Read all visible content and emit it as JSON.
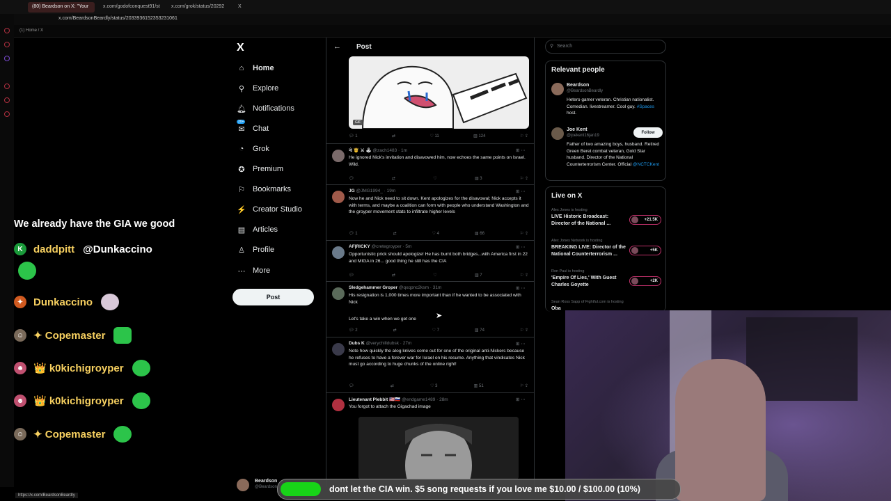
{
  "browser": {
    "tabs": [
      {
        "label": "(80) Beardson on X: \"Your",
        "active": true
      },
      {
        "label": "x.com/godofconquest91/st",
        "active": false
      },
      {
        "label": "x.com/grok/status/20292",
        "active": false
      },
      {
        "label": "X",
        "active": false
      }
    ],
    "url": "x.com/BeardsonBeardly/status/2033936152353231061",
    "bookmark": "(1) Home / X",
    "status_url": "https://x.com/BeardsonBeardly"
  },
  "sidebar": {
    "logo": "X",
    "items": [
      {
        "label": "Home",
        "icon": "⌂"
      },
      {
        "label": "Explore",
        "icon": "⚲"
      },
      {
        "label": "Notifications",
        "icon": "🔔︎"
      },
      {
        "label": "Chat",
        "icon": "✉"
      },
      {
        "label": "Grok",
        "icon": "◔"
      },
      {
        "label": "Premium",
        "icon": "✪"
      },
      {
        "label": "Bookmarks",
        "icon": "⚐"
      },
      {
        "label": "Creator Studio",
        "icon": "⚡"
      },
      {
        "label": "Articles",
        "icon": "▤"
      },
      {
        "label": "Profile",
        "icon": "♙"
      },
      {
        "label": "More",
        "icon": "⋯"
      }
    ],
    "post_label": "Post",
    "chat_badge": "20+",
    "account": {
      "name": "Beardson",
      "handle": "@Beardson"
    }
  },
  "timeline": {
    "title": "Post",
    "gif_badge": "GIF",
    "gif_actions": {
      "reply": "1",
      "repost": "",
      "like": "11",
      "views": "124"
    },
    "tweets": [
      {
        "name": "ᐛ 🤴 ⚔ 🕹",
        "handle": "@zach1483 · 1m",
        "text": "He ignored Nick's invitation and disavowed him, now echoes the same points on Israel. Wild.",
        "reply": "",
        "like": "",
        "views": "3"
      },
      {
        "name": "JG",
        "handle": "@JMG1994_ · 19m",
        "text": "Now he and Nick need to sit down. Kent apologizes for the disavowal; Nick accepts it with terms, and maybe a coalition can form with people who understand Washington and the groyper movement stats to infiltrate higher levels",
        "reply": "1",
        "like": "4",
        "views": "66"
      },
      {
        "name": "AF|RICKY",
        "handle": "@cretegroyper · 5m",
        "text": "Opportunistic prick should apologize! He has burnt both bridges...with America first in 22 and MIGA in 26... good thing he still has the CIA",
        "reply": "",
        "like": "",
        "views": "7"
      },
      {
        "name": "Sledgehammer Groper",
        "handle": "@qxqpnc2ksm · 31m",
        "text": "His resignation is 1,000 times more important than if he wanted to be associated with Nick",
        "text2": "Let's take a win when we get one",
        "reply": "2",
        "like": "7",
        "views": "74"
      },
      {
        "name": "Dubs K",
        "handle": "@verychilldubsk · 27m",
        "text": "Note how quickly the aIog knives come out for one of the original anti-Nickers because he refuses to have a forever war for Israel on his resume. Anything that vindicates Nick must go according to huge chunks of the online right!",
        "reply": "",
        "like": "3",
        "views": "51"
      },
      {
        "name": "Lieutenant Plebbit 🇺🇸🇷🇺",
        "handle": "@endgame1489 · 28m",
        "text": "You forgot to attach the Gigachad image",
        "reply": "",
        "like": "",
        "views": ""
      }
    ]
  },
  "right": {
    "search_placeholder": "Search",
    "relevant_title": "Relevant people",
    "people": [
      {
        "name": "Beardson",
        "handle": "@BeardsonBeardly",
        "bio": "Hetero gamer veteran. Christian nationalist. Comedian. livestreamer. Cool guy.",
        "bio_link": "#Spaces",
        "bio_tail": "host."
      },
      {
        "name": "Joe Kent",
        "handle": "@joekent16jan19",
        "bio": "Father of two amazing boys, husband. Retired Green Beret combat veteran, Gold Star husband. Director of the National Counterterrorism Center. Official",
        "bio_link": "@NCTCKent",
        "follow": "Follow"
      }
    ],
    "live_title": "Live on X",
    "live": [
      {
        "host": "Alex Jones",
        "hosting": "is hosting",
        "title": "LIVE Historic Broadcast: Director of the National ...",
        "count": "+21.5K"
      },
      {
        "host": "Alex Jones Network",
        "hosting": "is hosting",
        "title": "BREAKING LIVE: Director of the National Counterterrorism ...",
        "count": "+5K"
      },
      {
        "host": "Ron Paul",
        "hosting": "is hosting",
        "title": "'Empire Of Lies,' With Guest Charles Goyette",
        "count": "+2K"
      },
      {
        "host": "Sean Ross Sapp of Fightful.com",
        "hosting": "is hosting",
        "title": "Oba",
        "count": ""
      }
    ]
  },
  "chat": {
    "header": "We already have the GIA we good",
    "messages": [
      {
        "user": "daddpitt",
        "text": "@Dunkaccino",
        "icon": "K"
      },
      {
        "user": "Dunkaccino",
        "text": "",
        "icon": "✦"
      },
      {
        "user": "✦ Copemaster",
        "text": "",
        "icon": "☺"
      },
      {
        "user": "👑 k0kichigroyper",
        "text": "",
        "icon": "☻"
      },
      {
        "user": "👑 k0kichigroyper",
        "text": "",
        "icon": "☻"
      },
      {
        "user": "✦ Copemaster",
        "text": "",
        "icon": "☺"
      }
    ]
  },
  "song_request": "dont let the CIA win. $5 song requests if you love me $10.00 / $100.00 (10%)",
  "colors": {
    "accent": "#1d9bf0",
    "bg": "#000000",
    "border": "#2f3336",
    "live_ring": "#c0306a",
    "progress": "#18d318"
  },
  "song_progress": 0.1
}
